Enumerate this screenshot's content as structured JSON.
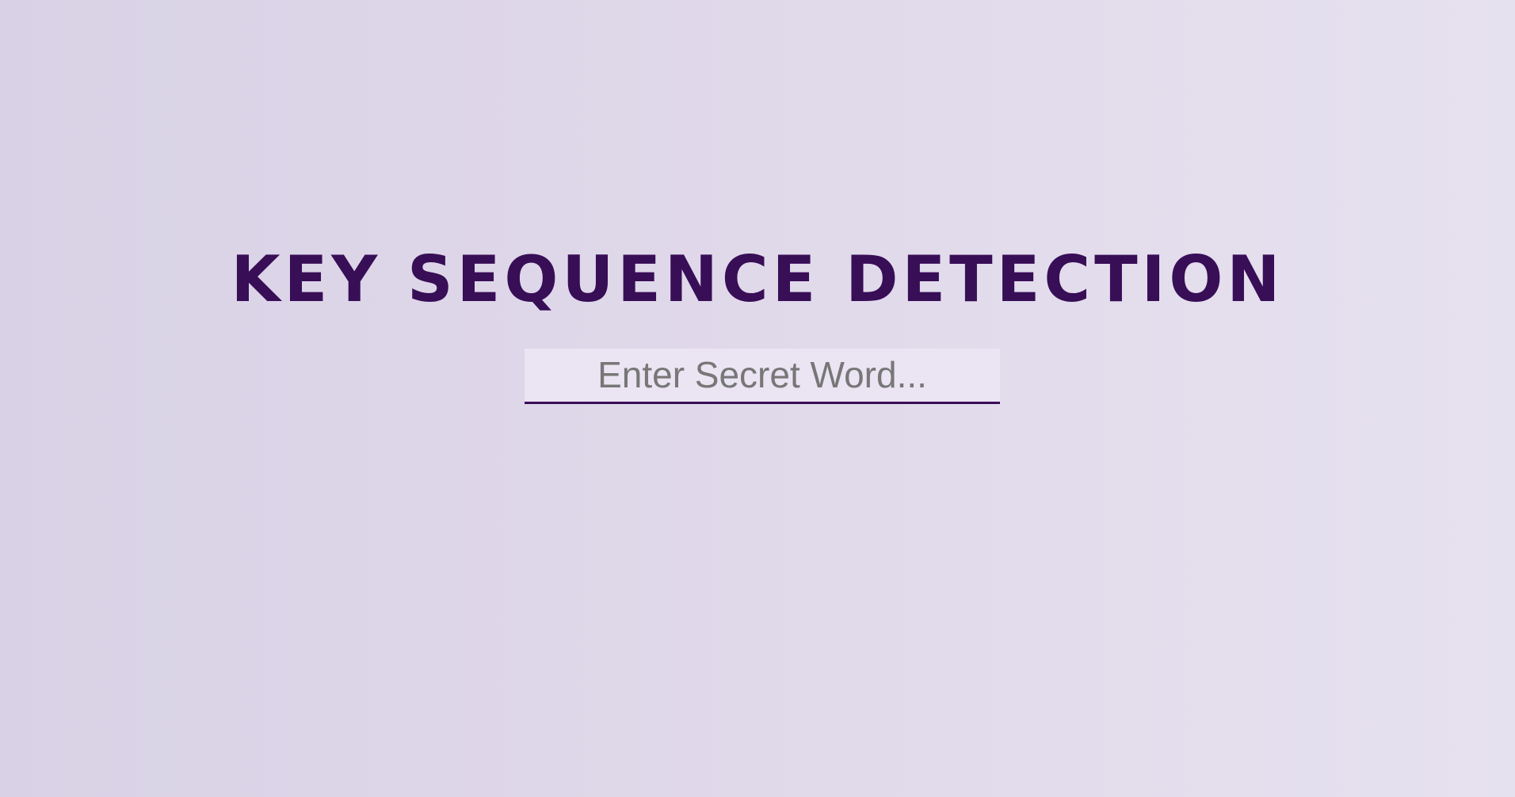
{
  "page": {
    "title": "KEY SEQUENCE DETECTION"
  },
  "secret_input": {
    "value": "",
    "placeholder": "Enter Secret Word..."
  },
  "colors": {
    "title": "#380e57",
    "input_underline": "#380e57",
    "input_background": "#ebe4f3",
    "placeholder": "#777777",
    "background_left": "#d9d2e6",
    "background_right": "#e6e1ef"
  }
}
